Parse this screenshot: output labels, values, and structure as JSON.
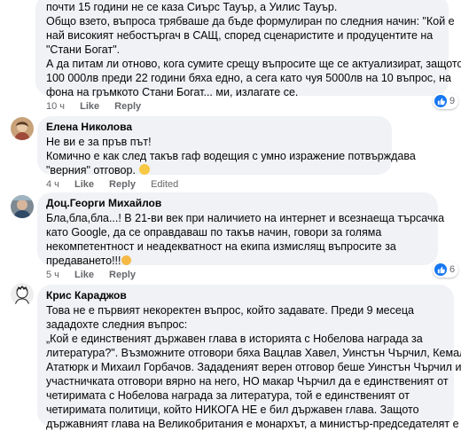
{
  "comment1": {
    "lines": [
      "почти 15 години не се каза Сиърс Тауър, а Уилис Тауър.",
      "Общо взето, въпроса трябваше да бъде формулиран по следния начин: \"Кой е",
      "най високият небостъргач в САЩ, според сценаристите и продуцентите на",
      "\"Стани Богат\".",
      "А да питам ли отново, кога сумите срещу въпросите ще се актуализират, защото",
      "100 000лв преди 22 години бяха едно, а сега като чуя 5000лв на 10 въпрос, на",
      "фона на гръмкото Стани Богат... ми, излагате се."
    ],
    "time": "10 ч",
    "like": "Like",
    "reply": "Reply",
    "reaction_count": "9"
  },
  "comment2": {
    "author": "Елена Николова",
    "lines": [
      "Не ви е за пръв път!",
      "Комично е как след такъв гаф водещия с умно изражение потвърждава",
      "\"верния\" отговор."
    ],
    "time": "4 ч",
    "like": "Like",
    "reply": "Reply",
    "edited": "Edited"
  },
  "comment3": {
    "author": "Доц.Георги Михайлов",
    "lines": [
      "Бла,бла,бла...! В 21-ви век при наличието на интернет и всезнаеща търсачка",
      "като Google, да се оправдаваш по такъв начин, говори за голяма",
      "некомпетентност и неадекватност на екипа измислящ въпросите за",
      "предаването!!!"
    ],
    "time": "5 ч",
    "like": "Like",
    "reply": "Reply",
    "reaction_count": "6"
  },
  "comment4": {
    "author": "Крис Караджов",
    "lines": [
      "Това не е първият некоректен въпрос, който задавате. Преди 9 месеца",
      "зададохте следния въпрос:",
      "„Кой е единственият държавен глава в историята с Нобелова награда за",
      "литература?\". Възможните отговори бяха Вацлав Хавел, Уинстън Чърчил, Кемал",
      "Ататюрк и Михаил Горбачов. Зададеният верен отговор беше Уинстън Чърчил и",
      "участничката отговори вярно на него, НО макар Чърчил да е единственият от",
      "четиримата с Нобелова награда за литература, той е единственият от",
      "четиримата политици, който НИКОГА НЕ е бил държавен глава. Защото",
      "държавният глава на Великобритания е монархът, а министър-председателят е"
    ]
  },
  "colors": {
    "bubble": "#f0f2f5",
    "meta": "#65676b",
    "like_blue": "#1877f2"
  }
}
